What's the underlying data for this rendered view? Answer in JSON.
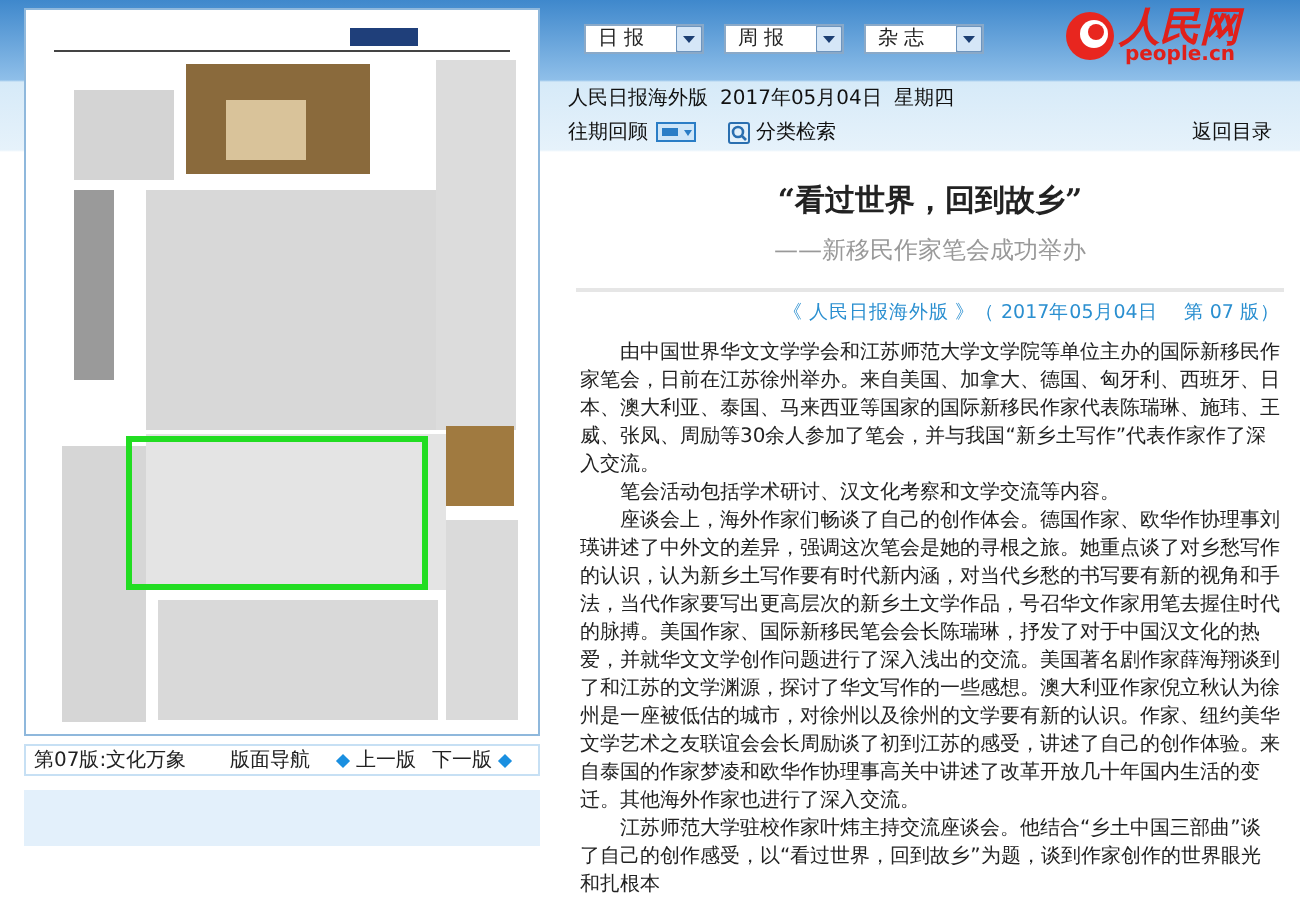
{
  "header": {
    "dropdowns": [
      {
        "label": "日 报"
      },
      {
        "label": "周 报"
      },
      {
        "label": "杂 志"
      }
    ],
    "logo": {
      "name": "人民网",
      "domain": "people.cn"
    },
    "edition": "人民日报海外版",
    "date": "2017年05月04日",
    "weekday": "星期四"
  },
  "toolbar": {
    "archive": "往期回顾",
    "category_search": "分类检索",
    "back": "返回目录"
  },
  "page_nav": {
    "section": "第07版:文化万象",
    "nav_label": "版面导航",
    "prev": "上一版",
    "next": "下一版"
  },
  "article": {
    "title": "“看过世界，回到故乡”",
    "subtitle": "——新移民作家笔会成功举办",
    "source": "《 人民日报海外版 》（ 2017年05月04日　 第 07 版）",
    "paragraphs": [
      "由中国世界华文文学学会和江苏师范大学文学院等单位主办的国际新移民作家笔会，日前在江苏徐州举办。来自美国、加拿大、德国、匈牙利、西班牙、日本、澳大利亚、泰国、马来西亚等国家的国际新移民作家代表陈瑞琳、施玮、王威、张凤、周励等30余人参加了笔会，并与我国“新乡土写作”代表作家作了深入交流。",
      "笔会活动包括学术研讨、汉文化考察和文学交流等内容。",
      "座谈会上，海外作家们畅谈了自己的创作体会。德国作家、欧华作协理事刘瑛讲述了中外文的差异，强调这次笔会是她的寻根之旅。她重点谈了对乡愁写作的认识，认为新乡土写作要有时代新内涵，对当代乡愁的书写要有新的视角和手法，当代作家要写出更高层次的新乡土文学作品，号召华文作家用笔去握住时代的脉搏。美国作家、国际新移民笔会会长陈瑞琳，抒发了对于中国汉文化的热爱，并就华文文学创作问题进行了深入浅出的交流。美国著名剧作家薛海翔谈到了和江苏的文学渊源，探讨了华文写作的一些感想。澳大利亚作家倪立秋认为徐州是一座被低估的城市，对徐州以及徐州的文学要有新的认识。作家、纽约美华文学艺术之友联谊会会长周励谈了初到江苏的感受，讲述了自己的创作体验。来自泰国的作家梦凌和欧华作协理事高关中讲述了改革开放几十年国内生活的变迁。其他海外作家也进行了深入交流。",
      "江苏师范大学驻校作家叶炜主持交流座谈会。他结合“乡土中国三部曲”谈了自己的创作感受，以“看过世界，回到故乡”为题，谈到作家创作的世界眼光和扎根本"
    ]
  }
}
